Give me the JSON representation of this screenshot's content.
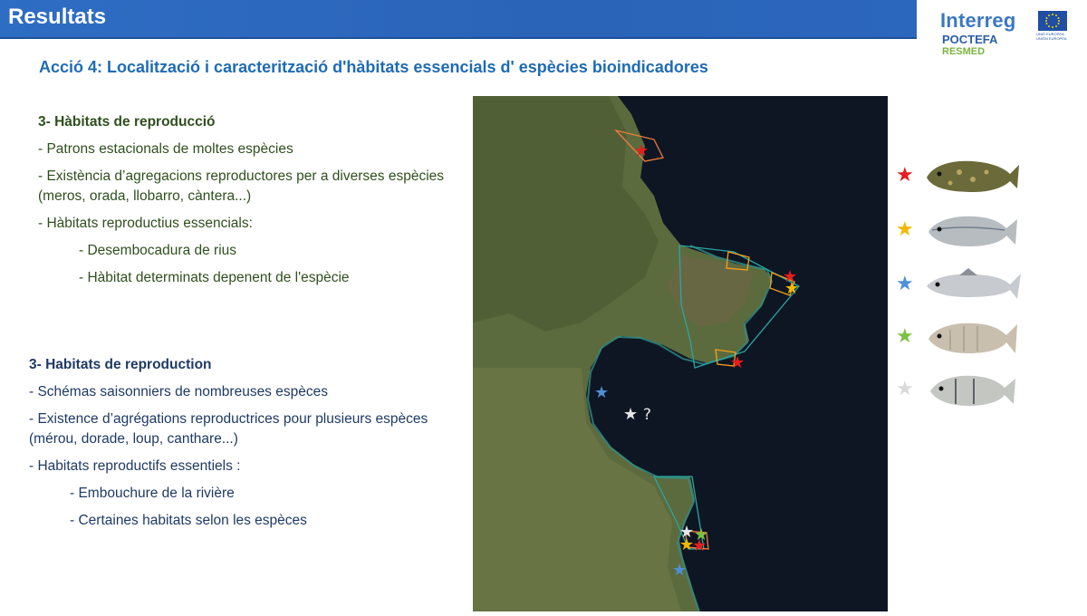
{
  "header": {
    "title": "Resultats"
  },
  "logo": {
    "interreg": "Interreg",
    "poctefa": "POCTEFA",
    "resmed": "RESMED",
    "flag_text": "UNIÓ EUROPEA UNIÓN EUROPEA"
  },
  "subtitle": "Acció 4: Localització i caracterització d'hàbitats essencials d' espècies bioindicadores",
  "catalan": {
    "heading": "3- Hàbitats de reproducció",
    "items": [
      "- Patrons estacionals de moltes espècies",
      "- Existència d’agregacions reproductores per a diverses espècies (meros, orada, llobarro, càntera...)",
      "- Hàbitats reproductius essencials:"
    ],
    "subitems": [
      "- Desembocadura de rius",
      "- Hàbitat determinats depenent de l'espècie"
    ]
  },
  "french": {
    "heading": "3- Habitats de reproduction",
    "items": [
      "- Schémas saisonniers de nombreuses espèces",
      "- Existence d’agrégations reproductrices pour plusieurs espèces (mérou, dorade, loup, canthare...)",
      "- Habitats reproductifs essentiels :"
    ],
    "subitems": [
      "- Embouchure de la rivière",
      "- Certaines habitats selon les espèces"
    ]
  },
  "map": {
    "question_mark": "?"
  },
  "legend": {
    "star_glyph": "★",
    "colors": [
      "#e81c1c",
      "#f5b800",
      "#4f8fd6",
      "#7cc142",
      "#d9d9d9"
    ],
    "fish": [
      "grouper-icon",
      "bream-icon",
      "seabass-icon",
      "seabream-icon",
      "sargo-icon"
    ]
  },
  "colors": {
    "header": "#2e6dc4",
    "subtitle": "#1f6bb3",
    "catalan_text": "#2f4f1e",
    "french_text": "#1f3a64"
  }
}
